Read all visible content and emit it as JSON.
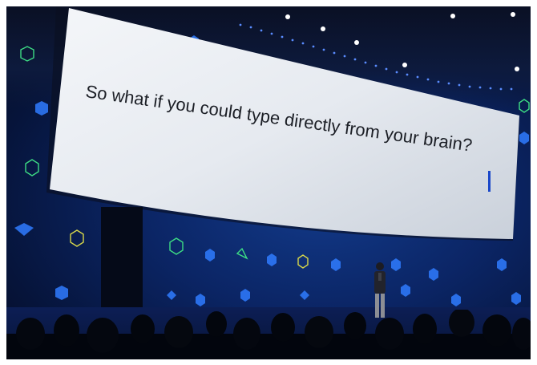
{
  "slide": {
    "text": "So what if you could type directly from your brain?"
  },
  "colors": {
    "screen": "#e6eaf0",
    "text": "#1c1f26",
    "caret": "#1a47c9",
    "backdrop": "#0b2565",
    "accent_blue": "#2f7bff",
    "accent_green": "#3ddc84"
  }
}
